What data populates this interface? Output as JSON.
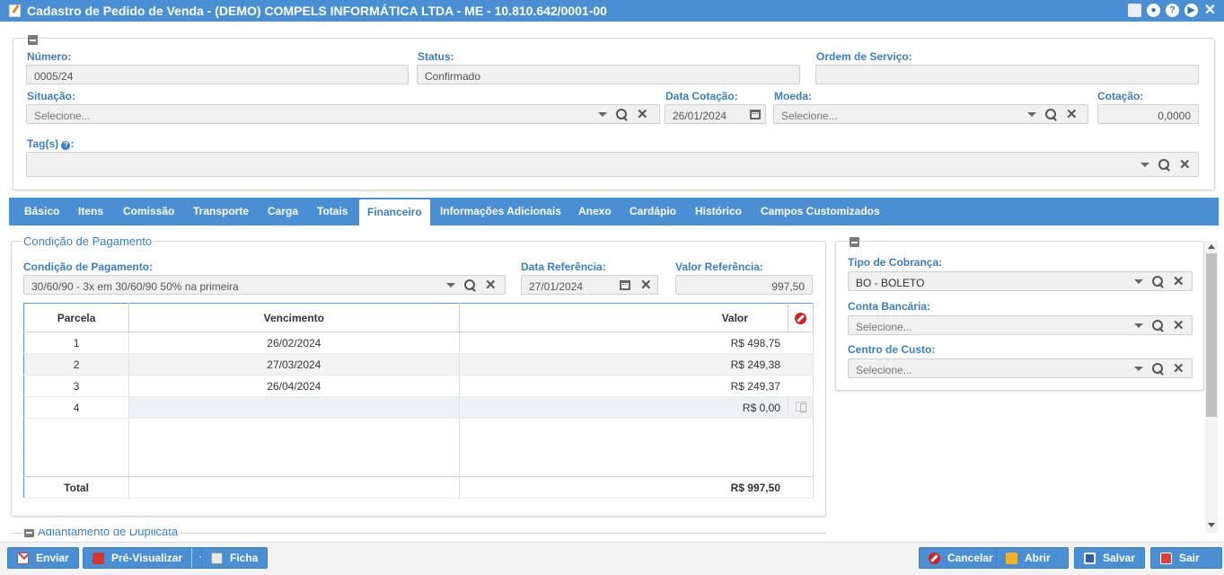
{
  "window": {
    "title": "Cadastro de Pedido de Venda - (DEMO) COMPELS INFORMÁTICA LTDA - ME - 10.810.642/0001-00",
    "help_glyph": "?"
  },
  "header": {
    "numero": {
      "label": "Número:",
      "value": "0005/24"
    },
    "status": {
      "label": "Status:",
      "value": "Confirmado"
    },
    "ordem_servico": {
      "label": "Ordem de Serviço:",
      "value": ""
    },
    "situacao": {
      "label": "Situação:",
      "value": "Selecione..."
    },
    "data_cotacao": {
      "label": "Data Cotação:",
      "value": "26/01/2024"
    },
    "moeda": {
      "label": "Moeda:",
      "value": "Selecione..."
    },
    "cotacao": {
      "label": "Cotação:",
      "value": "0,0000"
    },
    "tags": {
      "label": "Tag(s)",
      "value": ""
    }
  },
  "tabs": [
    {
      "label": "Básico"
    },
    {
      "label": "Itens"
    },
    {
      "label": "Comissão"
    },
    {
      "label": "Transporte"
    },
    {
      "label": "Carga"
    },
    {
      "label": "Totais"
    },
    {
      "label": "Financeiro",
      "active": true
    },
    {
      "label": "Informações Adicionais"
    },
    {
      "label": "Anexo"
    },
    {
      "label": "Cardápio"
    },
    {
      "label": "Histórico"
    },
    {
      "label": "Campos Customizados"
    }
  ],
  "payment": {
    "legend": "Condição de Pagamento",
    "condicao": {
      "label": "Condição de Pagamento:",
      "value": "30/60/90 - 3x em 30/60/90 50% na primeira"
    },
    "data_ref": {
      "label": "Data Referência:",
      "value": "27/01/2024"
    },
    "valor_ref": {
      "label": "Valor Referência:",
      "value": "997,50"
    },
    "grid": {
      "columns": [
        "Parcela",
        "Vencimento",
        "Valor"
      ],
      "rows": [
        {
          "parcela": "1",
          "vencimento": "26/02/2024",
          "valor": "R$ 498,75"
        },
        {
          "parcela": "2",
          "vencimento": "27/03/2024",
          "valor": "R$ 249,38"
        },
        {
          "parcela": "3",
          "vencimento": "26/04/2024",
          "valor": "R$ 249,37"
        },
        {
          "parcela": "4",
          "vencimento": "",
          "valor": "R$ 0,00"
        }
      ],
      "total_label": "Total",
      "total_value": "R$ 997,50"
    }
  },
  "billing": {
    "tipo_cobranca": {
      "label": "Tipo de Cobrança:",
      "value": "BO - BOLETO"
    },
    "conta_bancaria": {
      "label": "Conta Bancária:",
      "value": "Selecione..."
    },
    "centro_custo": {
      "label": "Centro de Custo:",
      "value": "Selecione..."
    }
  },
  "next_section": {
    "legend": "Adiantamento de Duplicata"
  },
  "buttons": {
    "enviar": "Enviar",
    "pre_visualizar": "Pré-Visualizar",
    "ficha": "Ficha",
    "cancelar": "Cancelar",
    "abrir": "Abrir",
    "salvar": "Salvar",
    "sair": "Sair"
  },
  "colors": {
    "accent": "#4a8fd4",
    "label": "#3a7ec4"
  }
}
